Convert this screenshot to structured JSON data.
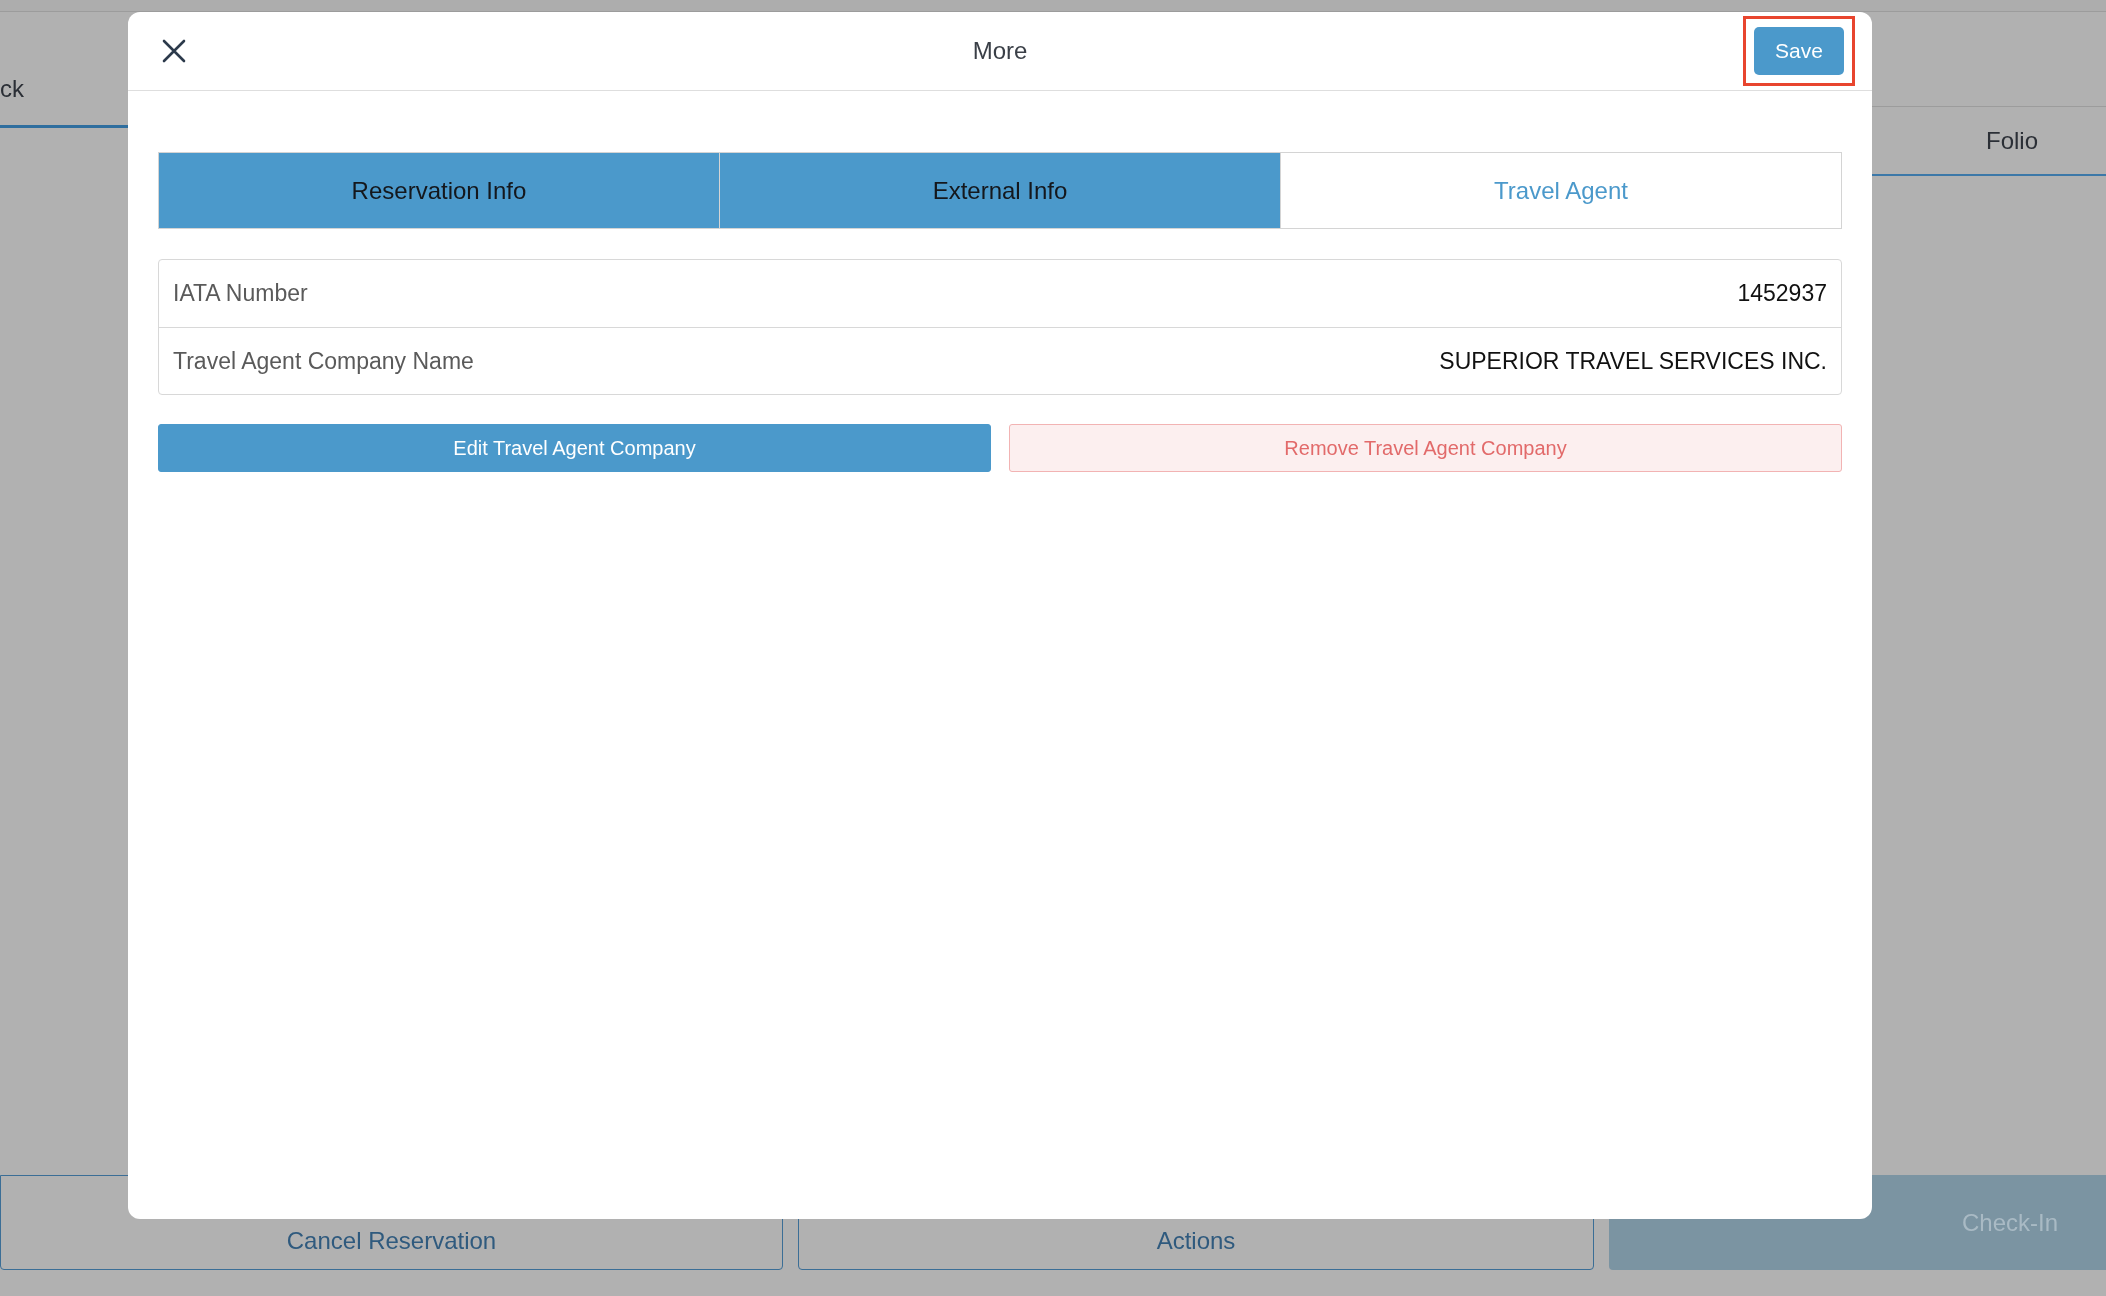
{
  "background": {
    "tabs": [
      {
        "label": "ck",
        "selected": true
      },
      {
        "label": "Folio",
        "selected": false
      }
    ],
    "buttons": [
      {
        "label": "Cancel Reservation",
        "kind": "outline"
      },
      {
        "label": "Actions",
        "kind": "outline"
      },
      {
        "label": "Check-In",
        "kind": "primary"
      }
    ]
  },
  "dialog": {
    "title": "More",
    "save": {
      "label": "Save",
      "highlighted": true
    },
    "tabs": [
      {
        "label": "Reservation Info",
        "selected": false
      },
      {
        "label": "External Info",
        "selected": false
      },
      {
        "label": "Travel Agent",
        "selected": true
      }
    ],
    "fields": [
      {
        "label": "IATA Number",
        "value": "1452937"
      },
      {
        "label": "Travel Agent Company Name",
        "value": "SUPERIOR TRAVEL SERVICES INC."
      }
    ],
    "actions": [
      {
        "label": "Edit Travel Agent Company",
        "kind": "primary"
      },
      {
        "label": "Remove Travel Agent Company",
        "kind": "danger"
      }
    ]
  }
}
